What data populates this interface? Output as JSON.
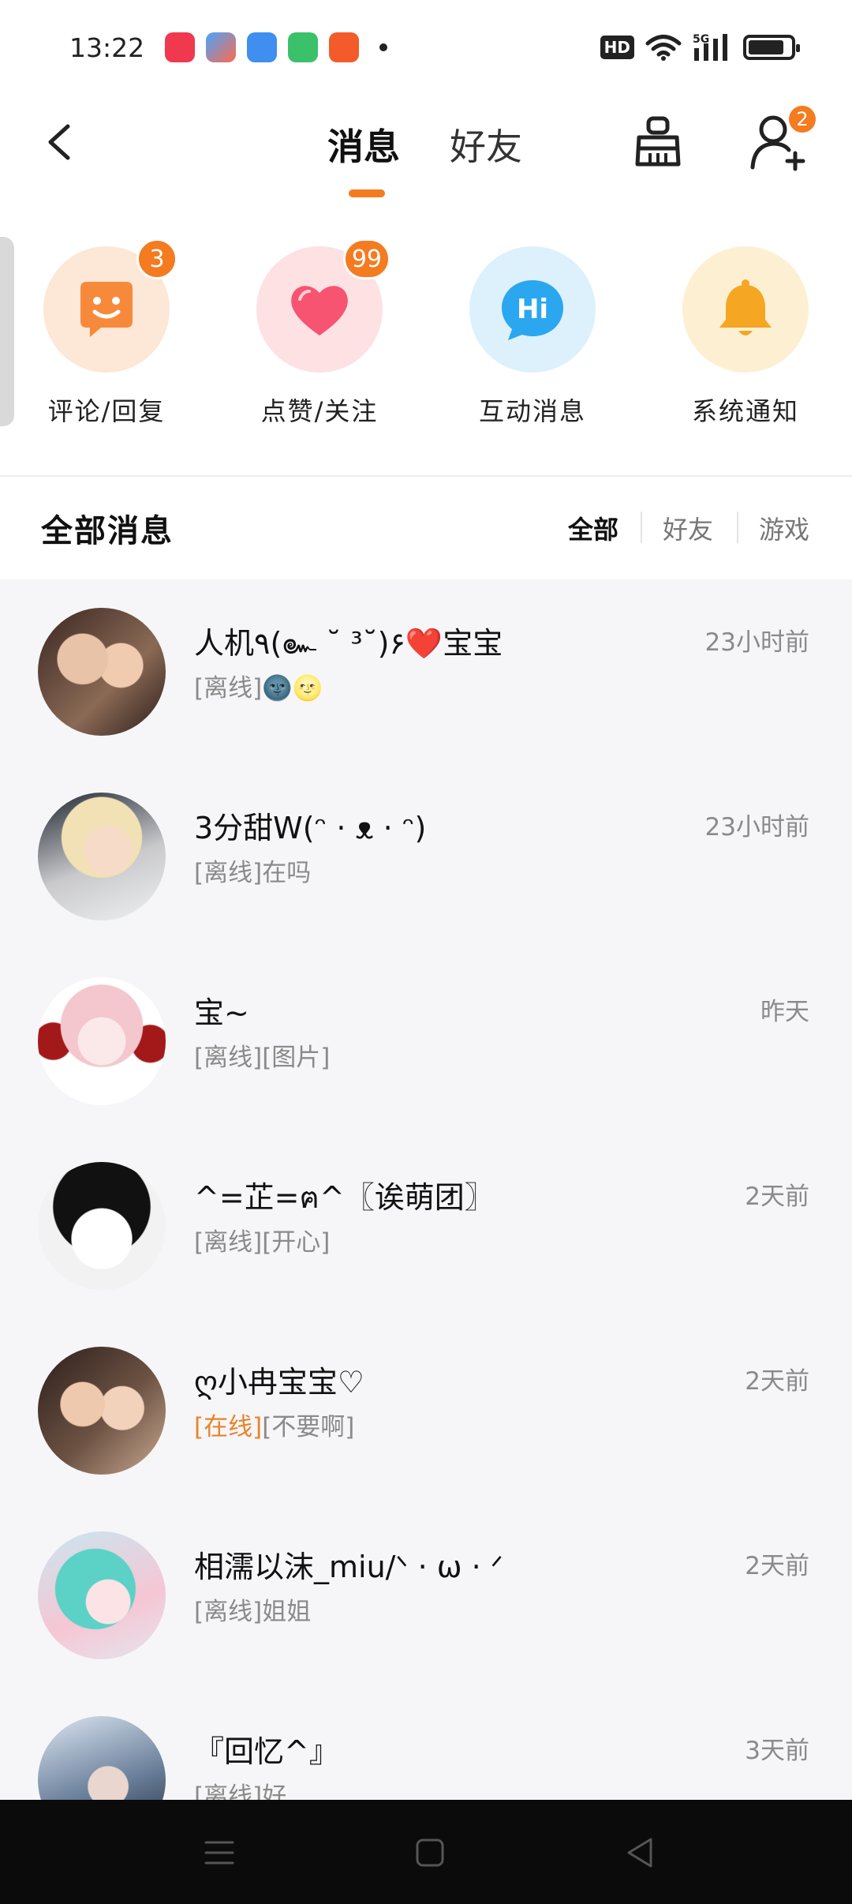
{
  "status_bar": {
    "time": "13:22",
    "hd": "HD",
    "network": "5G"
  },
  "header": {
    "tab_messages": "消息",
    "tab_friends": "好友",
    "add_friend_badge": "2"
  },
  "categories": [
    {
      "label": "评论/回复",
      "badge": "3",
      "icon": "smile-chat-icon"
    },
    {
      "label": "点赞/关注",
      "badge": "99",
      "icon": "heart-icon"
    },
    {
      "label": "互动消息",
      "badge": "",
      "icon": "hi-bubble-icon"
    },
    {
      "label": "系统通知",
      "badge": "",
      "icon": "bell-icon"
    }
  ],
  "section": {
    "title": "全部消息",
    "filters": [
      "全部",
      "好友",
      "游戏"
    ]
  },
  "messages": [
    {
      "name_a": "人机٩(๛ ˘ ³˘)۶",
      "name_heart": "❤️",
      "name_b": "宝宝",
      "status": "[离线]",
      "preview": "🌚🌝",
      "time": "23小时前"
    },
    {
      "name": "3分甜W(ᵔ · ᴥ · ᵔ)",
      "status": "[离线]",
      "preview": "在吗",
      "time": "23小时前"
    },
    {
      "name": "宝~",
      "status": "[离线]",
      "preview": "[图片]",
      "time": "昨天"
    },
    {
      "name": "^=芷=ฅ^〖诶萌团〗",
      "status": "[离线]",
      "preview": "[开心]",
      "time": "2天前"
    },
    {
      "name": "ღ小冉宝宝♡",
      "status": "[在线]",
      "preview": "[不要啊]",
      "time": "2天前"
    },
    {
      "name": "相濡以沫_miu/ᐠ · ω · ᐟ",
      "status": "[离线]",
      "preview": "姐姐",
      "time": "2天前"
    },
    {
      "name": "『回忆^』",
      "status": "[离线]",
      "preview": "好",
      "time": "3天前"
    }
  ],
  "colors": {
    "accent": "#f47b20",
    "online": "#e8842b",
    "list_bg": "#f6f6f8"
  }
}
